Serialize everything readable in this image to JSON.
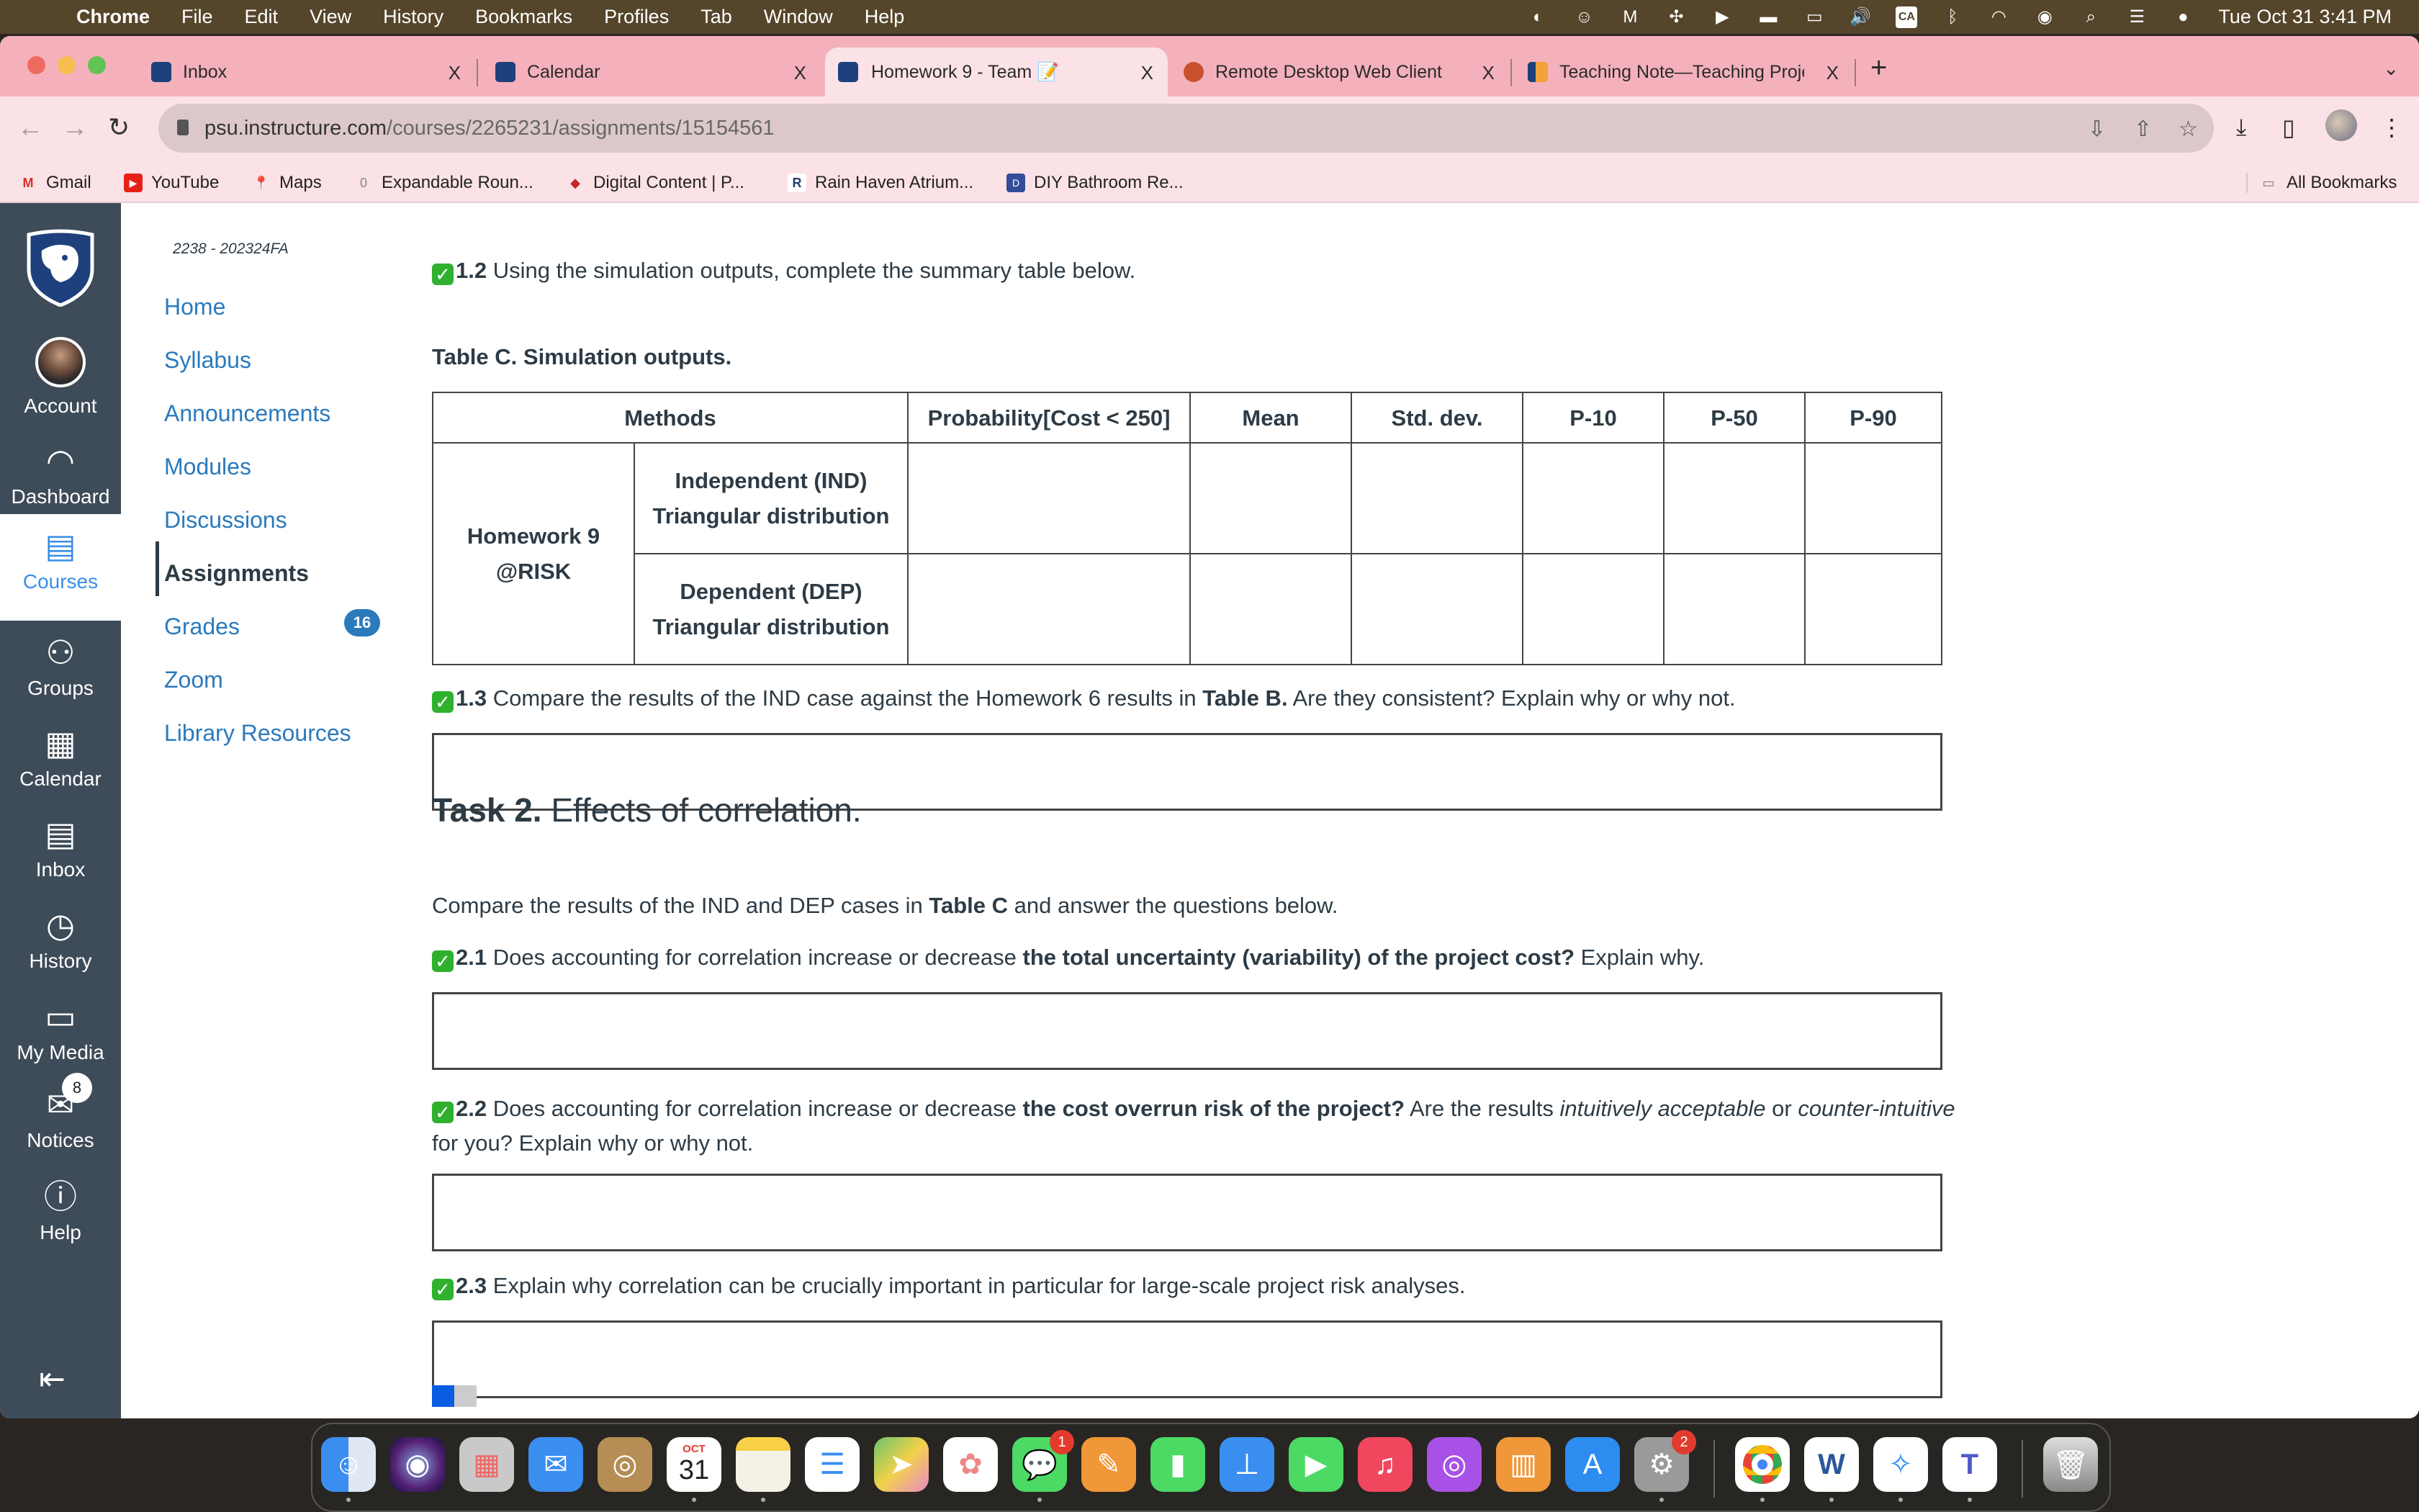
{
  "menubar": {
    "app": "Chrome",
    "items": [
      "File",
      "Edit",
      "View",
      "History",
      "Bookmarks",
      "Profiles",
      "Tab",
      "Window",
      "Help"
    ],
    "clock": "Tue Oct 31  3:41 PM",
    "input_source": "CA"
  },
  "browser": {
    "tabs": [
      {
        "title": "Inbox",
        "active": false
      },
      {
        "title": "Calendar",
        "active": false
      },
      {
        "title": "Homework 9 - Team 📝",
        "active": true
      },
      {
        "title": "Remote Desktop Web Client",
        "active": false
      },
      {
        "title": "Teaching Note—Teaching Proje",
        "active": false
      }
    ],
    "close_glyph": "X",
    "new_tab": "+",
    "url_host": "psu.instructure.com",
    "url_path": "/courses/2265231/assignments/15154561",
    "bookmarks": [
      {
        "label": "Gmail"
      },
      {
        "label": "YouTube"
      },
      {
        "label": "Maps"
      },
      {
        "label": "Expandable Roun..."
      },
      {
        "label": "Digital Content | P..."
      },
      {
        "label": "Rain Haven Atrium..."
      },
      {
        "label": "DIY Bathroom Re..."
      }
    ],
    "all_bookmarks": "All Bookmarks"
  },
  "global_nav": {
    "items": [
      {
        "label": "Account",
        "icon": "avatar"
      },
      {
        "label": "Dashboard",
        "icon": "speedometer-icon"
      },
      {
        "label": "Courses",
        "icon": "book-icon",
        "active": true
      },
      {
        "label": "Groups",
        "icon": "people-icon"
      },
      {
        "label": "Calendar",
        "icon": "calendar-icon"
      },
      {
        "label": "Inbox",
        "icon": "inbox-icon"
      },
      {
        "label": "History",
        "icon": "clock-icon"
      },
      {
        "label": "My Media",
        "icon": "monitor-icon"
      },
      {
        "label": "Notices",
        "icon": "envelope-icon",
        "badge": "8"
      },
      {
        "label": "Help",
        "icon": "question-icon"
      }
    ]
  },
  "course_nav": {
    "term": "2238 - 202324FA",
    "items": [
      {
        "label": "Home"
      },
      {
        "label": "Syllabus"
      },
      {
        "label": "Announcements"
      },
      {
        "label": "Modules"
      },
      {
        "label": "Discussions"
      },
      {
        "label": "Assignments",
        "active": true
      },
      {
        "label": "Grades",
        "badge": "16"
      },
      {
        "label": "Zoom"
      },
      {
        "label": "Library Resources"
      }
    ]
  },
  "content": {
    "q12": {
      "num": "1.2",
      "text": " Using the simulation outputs, complete the summary table below."
    },
    "table_caption": "Table C. Simulation outputs.",
    "table": {
      "headers": [
        "Methods",
        "Probability[Cost < 250]",
        "Mean",
        "Std. dev.",
        "P-10",
        "P-50",
        "P-90"
      ],
      "group_label_line1": "Homework 9",
      "group_label_line2": "@RISK",
      "rows": [
        {
          "line1": "Independent (IND)",
          "line2": "Triangular distribution",
          "values": [
            "",
            "",
            "",
            "",
            "",
            ""
          ]
        },
        {
          "line1": "Dependent (DEP)",
          "line2": "Triangular distribution",
          "values": [
            "",
            "",
            "",
            "",
            "",
            ""
          ]
        }
      ]
    },
    "q13": {
      "num": "1.3",
      "t1": " Compare the results of the IND case against the Homework 6 results in ",
      "b1": "Table B.",
      "t2": " Are they consistent? Explain why or why not."
    },
    "task2_bold": "Task 2.",
    "task2_rest": " Effects of correlation.",
    "intro": {
      "t1": "Compare the results of the IND and DEP cases in ",
      "b1": "Table C",
      "t2": " and answer the questions below."
    },
    "q21": {
      "num": "2.1",
      "t1": " Does accounting for correlation increase or decrease ",
      "b1": "the total uncertainty (variability) of the project cost?",
      "t2": " Explain why."
    },
    "q22": {
      "num": "2.2",
      "t1": "  Does accounting for correlation increase or decrease ",
      "b1": "the cost overrun risk of the project?",
      "t2": " Are the results ",
      "i1": "intuitively acceptable",
      "t3": " or ",
      "i2": "counter-intuitive",
      "t4": " for you? Explain why or why not."
    },
    "q23": {
      "num": "2.3",
      "text": " Explain why correlation can be crucially important in particular for large-scale project risk analyses."
    },
    "answers": [
      {
        "value": ""
      },
      {
        "value": ""
      },
      {
        "value": ""
      },
      {
        "value": ""
      }
    ]
  },
  "dock": {
    "apps": [
      "Finder",
      "Siri",
      "Launchpad",
      "Mail",
      "Contacts",
      "Calendar",
      "Notes",
      "Reminders",
      "Maps",
      "Photos",
      "Messages",
      "Pages",
      "Numbers",
      "Keynote",
      "FaceTime",
      "Music",
      "Podcasts",
      "Books",
      "App Store",
      "System Settings",
      "Chrome",
      "Word",
      "Safari",
      "Teams",
      "Trash"
    ],
    "calendar_month": "OCT",
    "calendar_day": "31",
    "messages_badge": "1",
    "settings_badge": "2"
  },
  "colors": {
    "canvas_nav": "#3e4b58",
    "link": "#2b7abc",
    "tabstrip": "#f4b1bb",
    "check": "#2fb12f"
  }
}
